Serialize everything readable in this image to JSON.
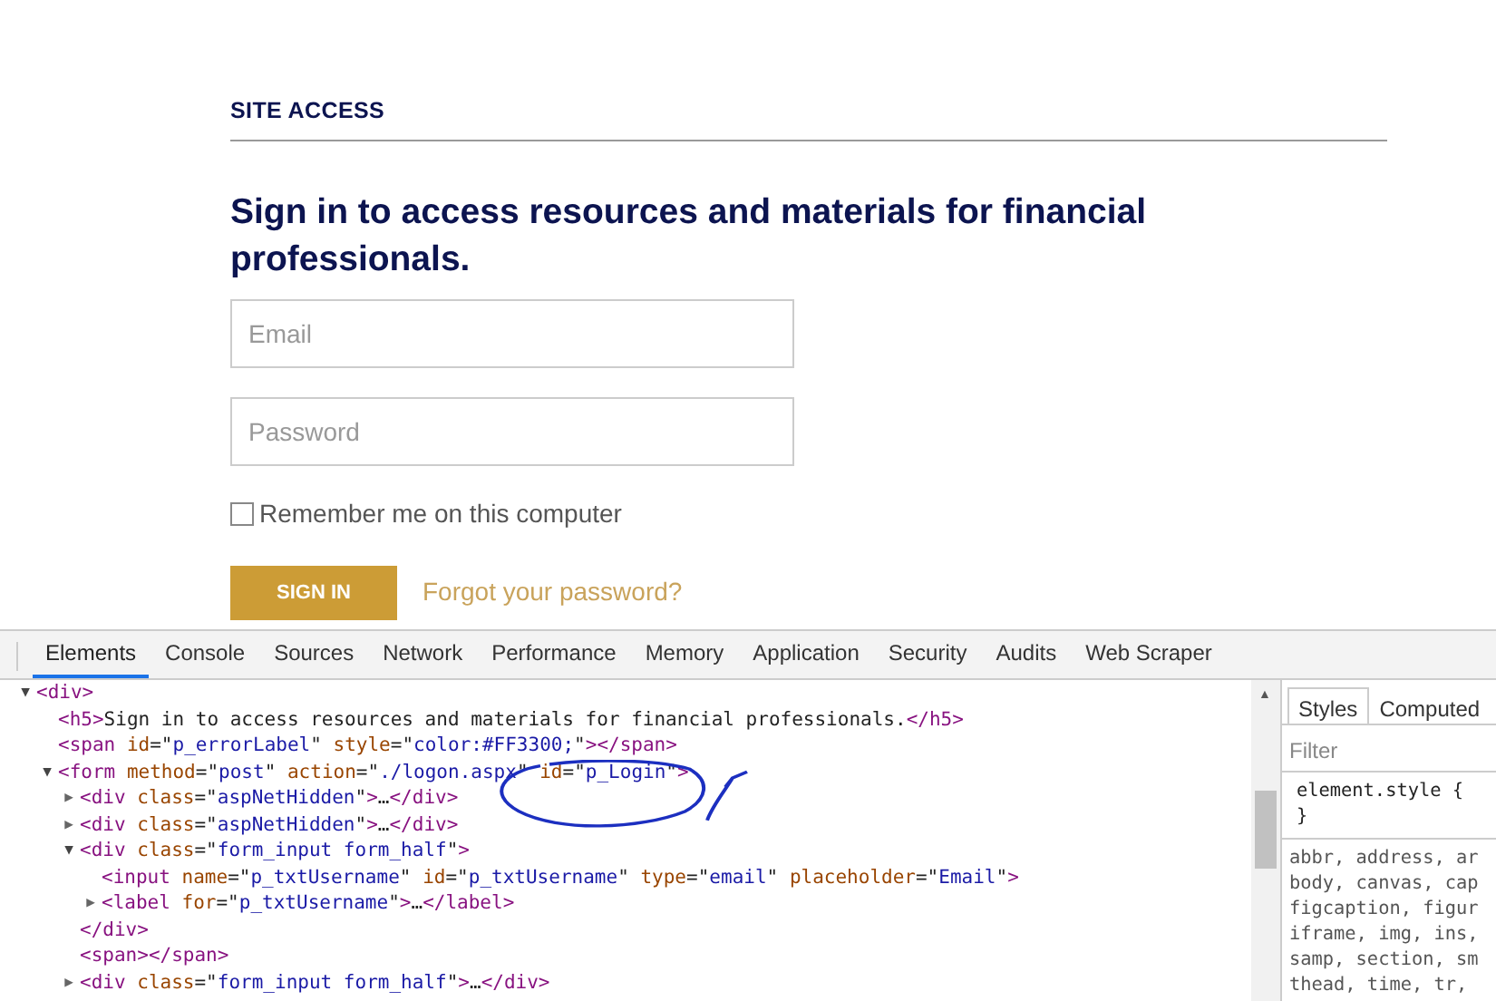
{
  "page": {
    "section_title": "SITE ACCESS",
    "heading": "Sign in to access resources and materials for financial professionals.",
    "fields": [
      {
        "placeholder": "Email"
      },
      {
        "placeholder": "Password"
      }
    ],
    "remember": {
      "label": "Remember me on this computer",
      "checked": false
    },
    "sign_in_button": "SIGN IN",
    "forgot_link": "Forgot your password?"
  },
  "devtools": {
    "tabs": [
      {
        "label": "Elements",
        "selected": true
      },
      {
        "label": "Console",
        "selected": false
      },
      {
        "label": "Sources",
        "selected": false
      },
      {
        "label": "Network",
        "selected": false
      },
      {
        "label": "Performance",
        "selected": false
      },
      {
        "label": "Memory",
        "selected": false
      },
      {
        "label": "Application",
        "selected": false
      },
      {
        "label": "Security",
        "selected": false
      },
      {
        "label": "Audits",
        "selected": false
      },
      {
        "label": "Web Scraper",
        "selected": false
      }
    ],
    "dom_tree": [
      {
        "text": "<div>",
        "toggle": "▼",
        "expanded": true,
        "children": [
          {
            "text": "<h5>Sign in to access resources and materials for financial professionals.</h5>"
          },
          {
            "text": "<span id=\"p_errorLabel\" style=\"color:#FF3300;\"></span>"
          },
          {
            "text": "<form method=\"post\" action=\"./logon.aspx\" id=\"p_Login\">",
            "toggle": "▼",
            "expanded": true,
            "children": [
              {
                "text": "<div class=\"aspNetHidden\">…</div>",
                "toggle": "▶",
                "expanded": false
              },
              {
                "text": "<div class=\"aspNetHidden\">…</div>",
                "toggle": "▶",
                "expanded": false
              },
              {
                "text": "<div class=\"form_input form_half\">",
                "toggle": "▼",
                "expanded": true,
                "closing": "</div>",
                "children": [
                  {
                    "text": "<input name=\"p_txtUsername\" id=\"p_txtUsername\" type=\"email\" placeholder=\"Email\">"
                  },
                  {
                    "text": "<label for=\"p_txtUsername\">…</label>",
                    "toggle": "▶",
                    "expanded": false
                  }
                ]
              },
              {
                "text": "<span></span>"
              },
              {
                "text": "<div class=\"form_input form_half\">…</div>",
                "toggle": "▶",
                "expanded": false
              }
            ]
          }
        ]
      }
    ],
    "side_tabs": [
      {
        "label": "Styles",
        "selected": true
      },
      {
        "label": "Computed",
        "selected": false
      }
    ],
    "filter_placeholder": "Filter",
    "style_rule": {
      "selector": "element.style {",
      "close": "}"
    },
    "scroll_up_arrow": "▲",
    "style_lines": [
      "abbr, address, ar",
      "body, canvas, cap",
      "figcaption, figur",
      "iframe, img, ins,",
      "samp, section, sm",
      "thead, time, tr,"
    ]
  }
}
